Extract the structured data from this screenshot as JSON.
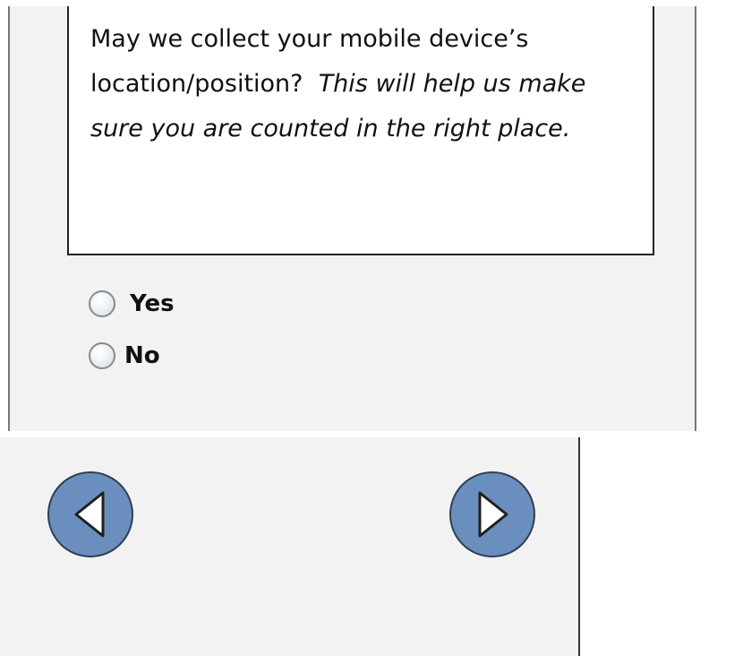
{
  "question": {
    "text": "May we collect your mobile device’s location/position?",
    "hint": "This will help us make sure you are counted in the right place."
  },
  "options": [
    {
      "label": "Yes",
      "selected": false
    },
    {
      "label": "No",
      "selected": false
    }
  ],
  "navigation": {
    "back_icon": "triangle-left-icon",
    "next_icon": "triangle-right-icon"
  },
  "colors": {
    "panel_background": "#f2f2f2",
    "nav_button_fill": "#6a8fbe",
    "nav_button_border": "#2f3f55"
  }
}
